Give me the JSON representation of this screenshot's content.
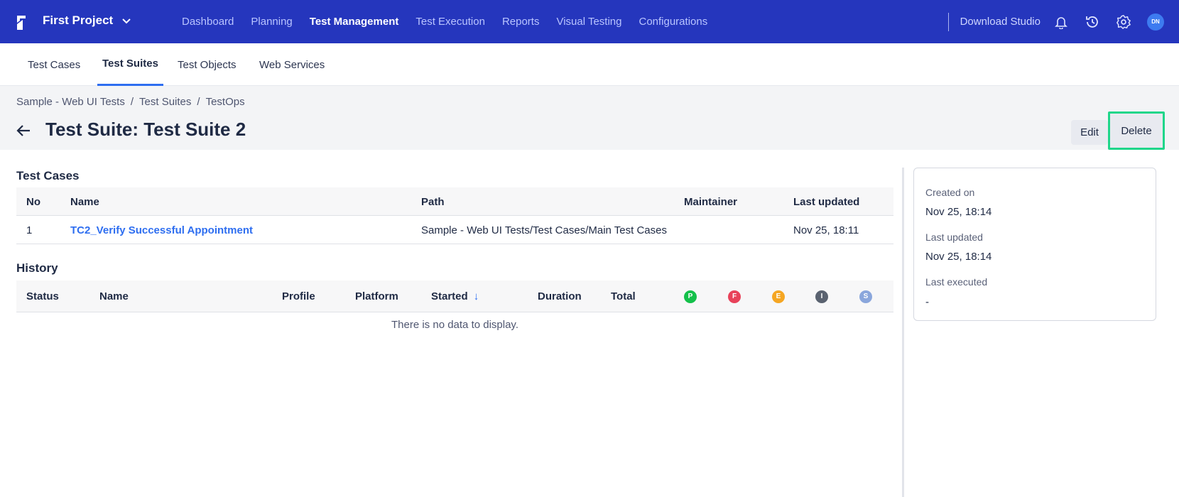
{
  "topnav": {
    "project_name": "First Project",
    "items": [
      {
        "label": "Dashboard"
      },
      {
        "label": "Planning"
      },
      {
        "label": "Test Management"
      },
      {
        "label": "Test Execution"
      },
      {
        "label": "Reports"
      },
      {
        "label": "Visual Testing"
      },
      {
        "label": "Configurations"
      }
    ],
    "active_item": "Test Management",
    "download_label": "Download Studio",
    "avatar_initials": "DN",
    "icons": [
      "logo-icon",
      "chevron-down-icon",
      "bell-icon",
      "history-icon",
      "gear-icon"
    ]
  },
  "subtabs": {
    "items": [
      {
        "label": "Test Cases"
      },
      {
        "label": "Test Suites"
      },
      {
        "label": "Test Objects"
      },
      {
        "label": "Web Services"
      }
    ],
    "active": "Test Suites"
  },
  "breadcrumb": [
    "Sample - Web UI Tests",
    "Test Suites",
    "TestOps"
  ],
  "page_title": "Test Suite: Test Suite 2",
  "actions": {
    "edit_label": "Edit",
    "delete_label": "Delete"
  },
  "test_cases": {
    "title": "Test Cases",
    "columns": [
      "No",
      "Name",
      "Path",
      "Maintainer",
      "Last updated"
    ],
    "rows": [
      {
        "no": "1",
        "name": "TC2_Verify Successful Appointment",
        "path": "Sample - Web UI Tests/Test Cases/Main Test Cases",
        "maintainer": "",
        "last_updated": "Nov 25, 18:11"
      }
    ]
  },
  "history": {
    "title": "History",
    "columns": [
      "Status",
      "Name",
      "Profile",
      "Platform",
      "Started",
      "Duration",
      "Total"
    ],
    "sort_column": "Started",
    "status_badges": [
      {
        "letter": "P",
        "color": "#14c04a"
      },
      {
        "letter": "F",
        "color": "#e8425a"
      },
      {
        "letter": "E",
        "color": "#f5a623"
      },
      {
        "letter": "I",
        "color": "#5a6270"
      },
      {
        "letter": "S",
        "color": "#8aa6dc"
      }
    ],
    "empty_text": "There is no data to display."
  },
  "info": {
    "created_label": "Created on",
    "created_value": "Nov 25, 18:14",
    "updated_label": "Last updated",
    "updated_value": "Nov 25, 18:14",
    "executed_label": "Last executed",
    "executed_value": "-"
  },
  "colors": {
    "topnav_bg": "#2536bd",
    "accent": "#2e6ef0",
    "highlight_border": "#1fd68a"
  }
}
